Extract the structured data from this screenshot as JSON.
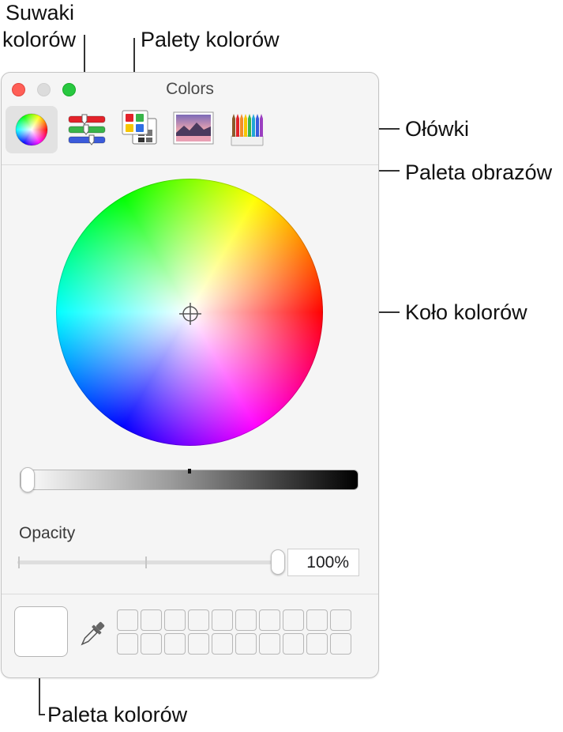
{
  "annotations": {
    "sliders_line1": "Suwaki",
    "sliders_line2": "kolorów",
    "palettes": "Palety kolorów",
    "pencils": "Ołówki",
    "image_palette": "Paleta obrazów",
    "color_wheel": "Koło kolorów",
    "color_palette": "Paleta kolorów"
  },
  "window": {
    "title": "Colors"
  },
  "toolbar": {
    "selected_tool": "color-wheel",
    "tools": [
      "color-wheel-icon",
      "color-sliders-icon",
      "color-palettes-icon",
      "image-palettes-icon",
      "pencils-icon"
    ]
  },
  "opacity": {
    "label": "Opacity",
    "value_text": "100%",
    "value": 1.0
  },
  "brightness": {
    "value": 0.0
  },
  "swatches": {
    "rows": 2,
    "columns": 10
  },
  "colors": {
    "close": "#ff5f57",
    "minimize": "#dcdcdc",
    "maximize": "#28c840",
    "window_bg": "#f5f5f5"
  }
}
